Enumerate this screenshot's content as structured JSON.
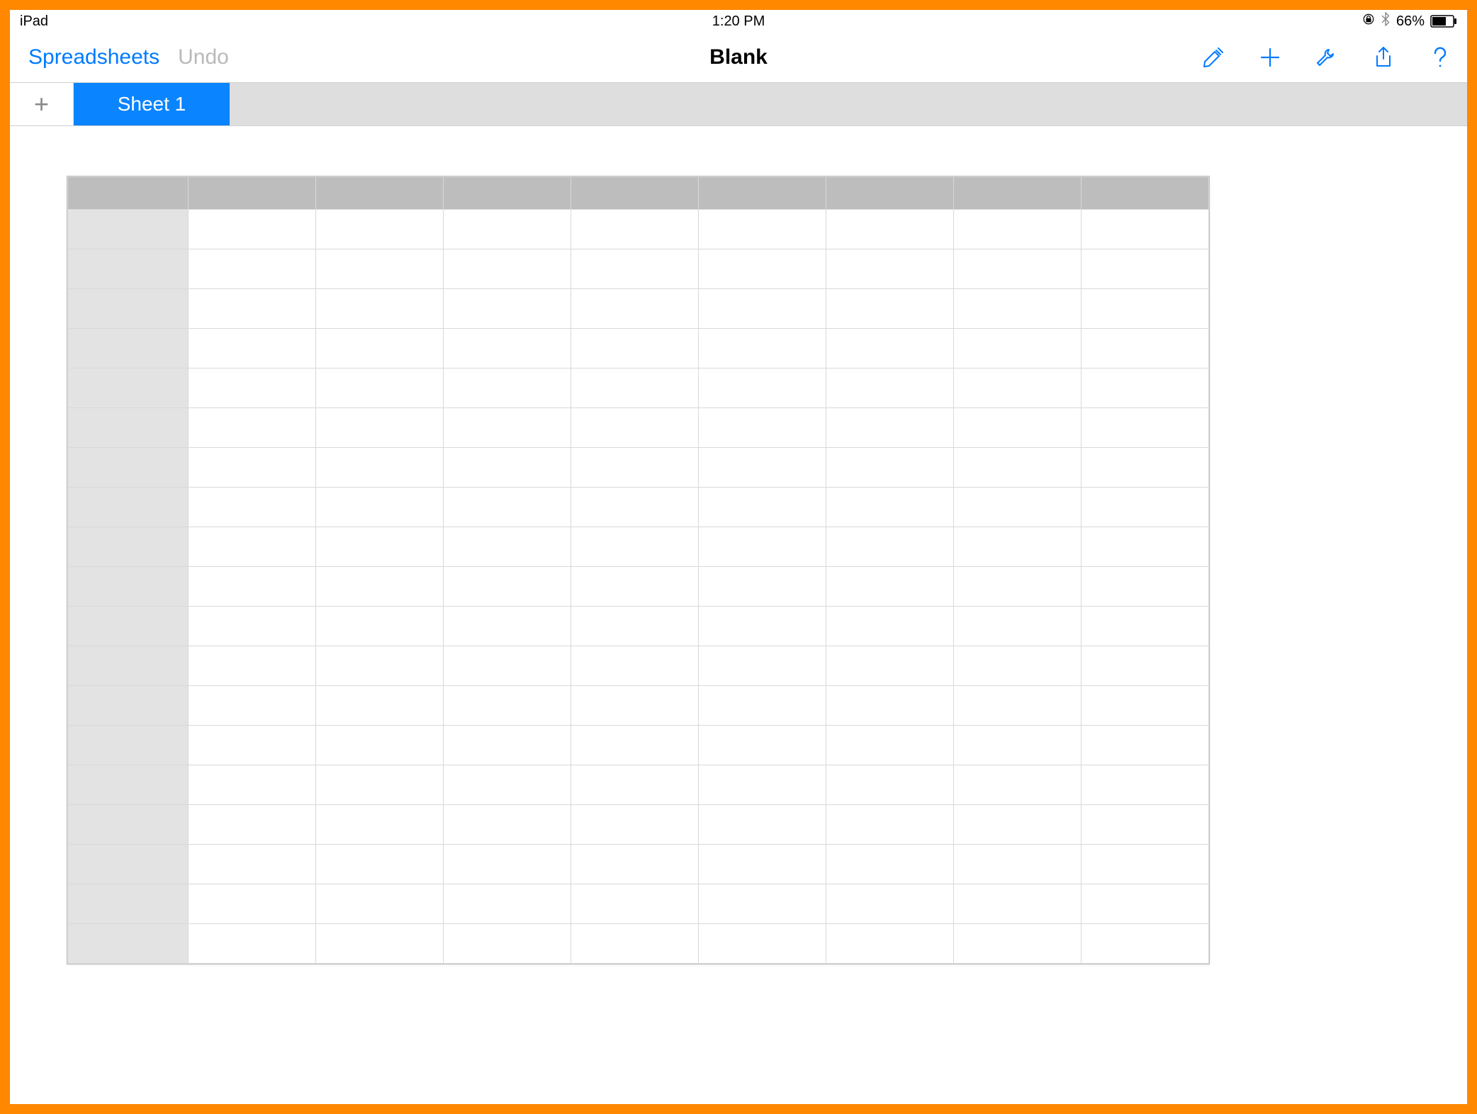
{
  "statusbar": {
    "device": "iPad",
    "time": "1:20 PM",
    "battery_pct": "66%"
  },
  "toolbar": {
    "back_label": "Spreadsheets",
    "undo_label": "Undo",
    "title": "Blank"
  },
  "tabs": {
    "add_symbol": "+",
    "active_label": "Sheet 1"
  },
  "icons": {
    "format_brush": "format-brush-icon",
    "plus": "plus-icon",
    "wrench": "wrench-icon",
    "share": "share-icon",
    "help": "help-icon",
    "lock": "orientation-lock-icon",
    "bluetooth": "bluetooth-icon",
    "battery": "battery-icon"
  },
  "grid": {
    "columns": 8,
    "rows": 19
  },
  "colors": {
    "accent": "#007aff",
    "tab_active": "#0a84ff",
    "frame": "#ff8800"
  }
}
